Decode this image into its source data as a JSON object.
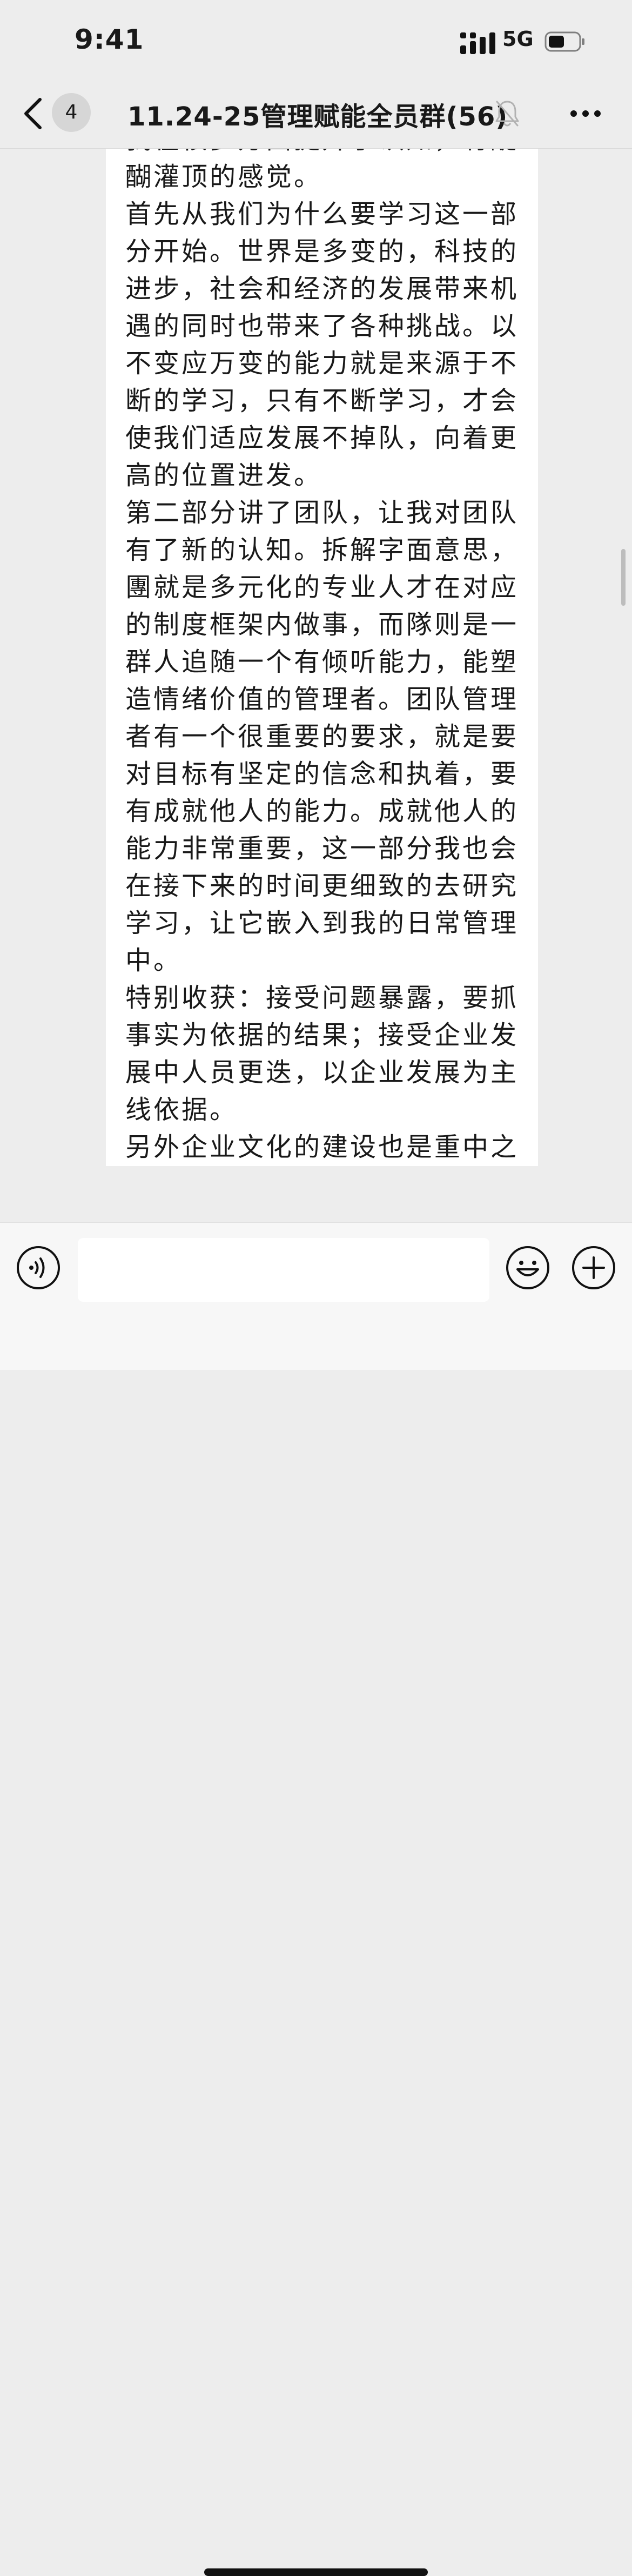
{
  "status_bar": {
    "time": "9:41",
    "network": "5G",
    "signal_icon": "signal-bars-icon",
    "battery_icon": "battery-icon"
  },
  "nav": {
    "back_icon": "chevron-left-icon",
    "unread_count": "4",
    "title": "11.24-25管理赋能全员群(56)",
    "mute_icon": "bell-muted-icon",
    "more_icon": "more-dots-icon"
  },
  "message": {
    "text": "首先非常感谢郭老师的授课，让\n我在很多方面提升了认知，有醍\n醐灌顶的感觉。\n首先从我们为什么要学习这一部\n分开始。世界是多变的，科技的\n进步，社会和经济的发展带来机\n遇的同时也带来了各种挑战。以\n不变应万变的能力就是来源于不\n断的学习，只有不断学习，才会\n使我们适应发展不掉队，向着更\n高的位置进发。\n第二部分讲了团队，让我对团队\n有了新的认知。拆解字面意思，\n團就是多元化的专业人才在对应\n的制度框架内做事，而隊则是一\n群人追随一个有倾听能力，能塑\n造情绪价值的管理者。团队管理\n者有一个很重要的要求，就是要\n对目标有坚定的信念和执着，要\n有成就他人的能力。成就他人的\n能力非常重要，这一部分我也会\n在接下来的时间更细致的去研究\n学习，让它嵌入到我的日常管理\n中。\n特别收获：接受问题暴露，要抓\n事实为依据的结果；接受企业发\n展中人员更迭，以企业发展为主\n线依据。\n另外企业文化的建设也是重中之"
  },
  "input_bar": {
    "voice_icon": "voice-icon",
    "input_value": "",
    "emoji_icon": "emoji-icon",
    "plus_icon": "plus-icon"
  },
  "colors": {
    "background": "#ededed",
    "bubble": "#ffffff",
    "text": "#191919"
  }
}
